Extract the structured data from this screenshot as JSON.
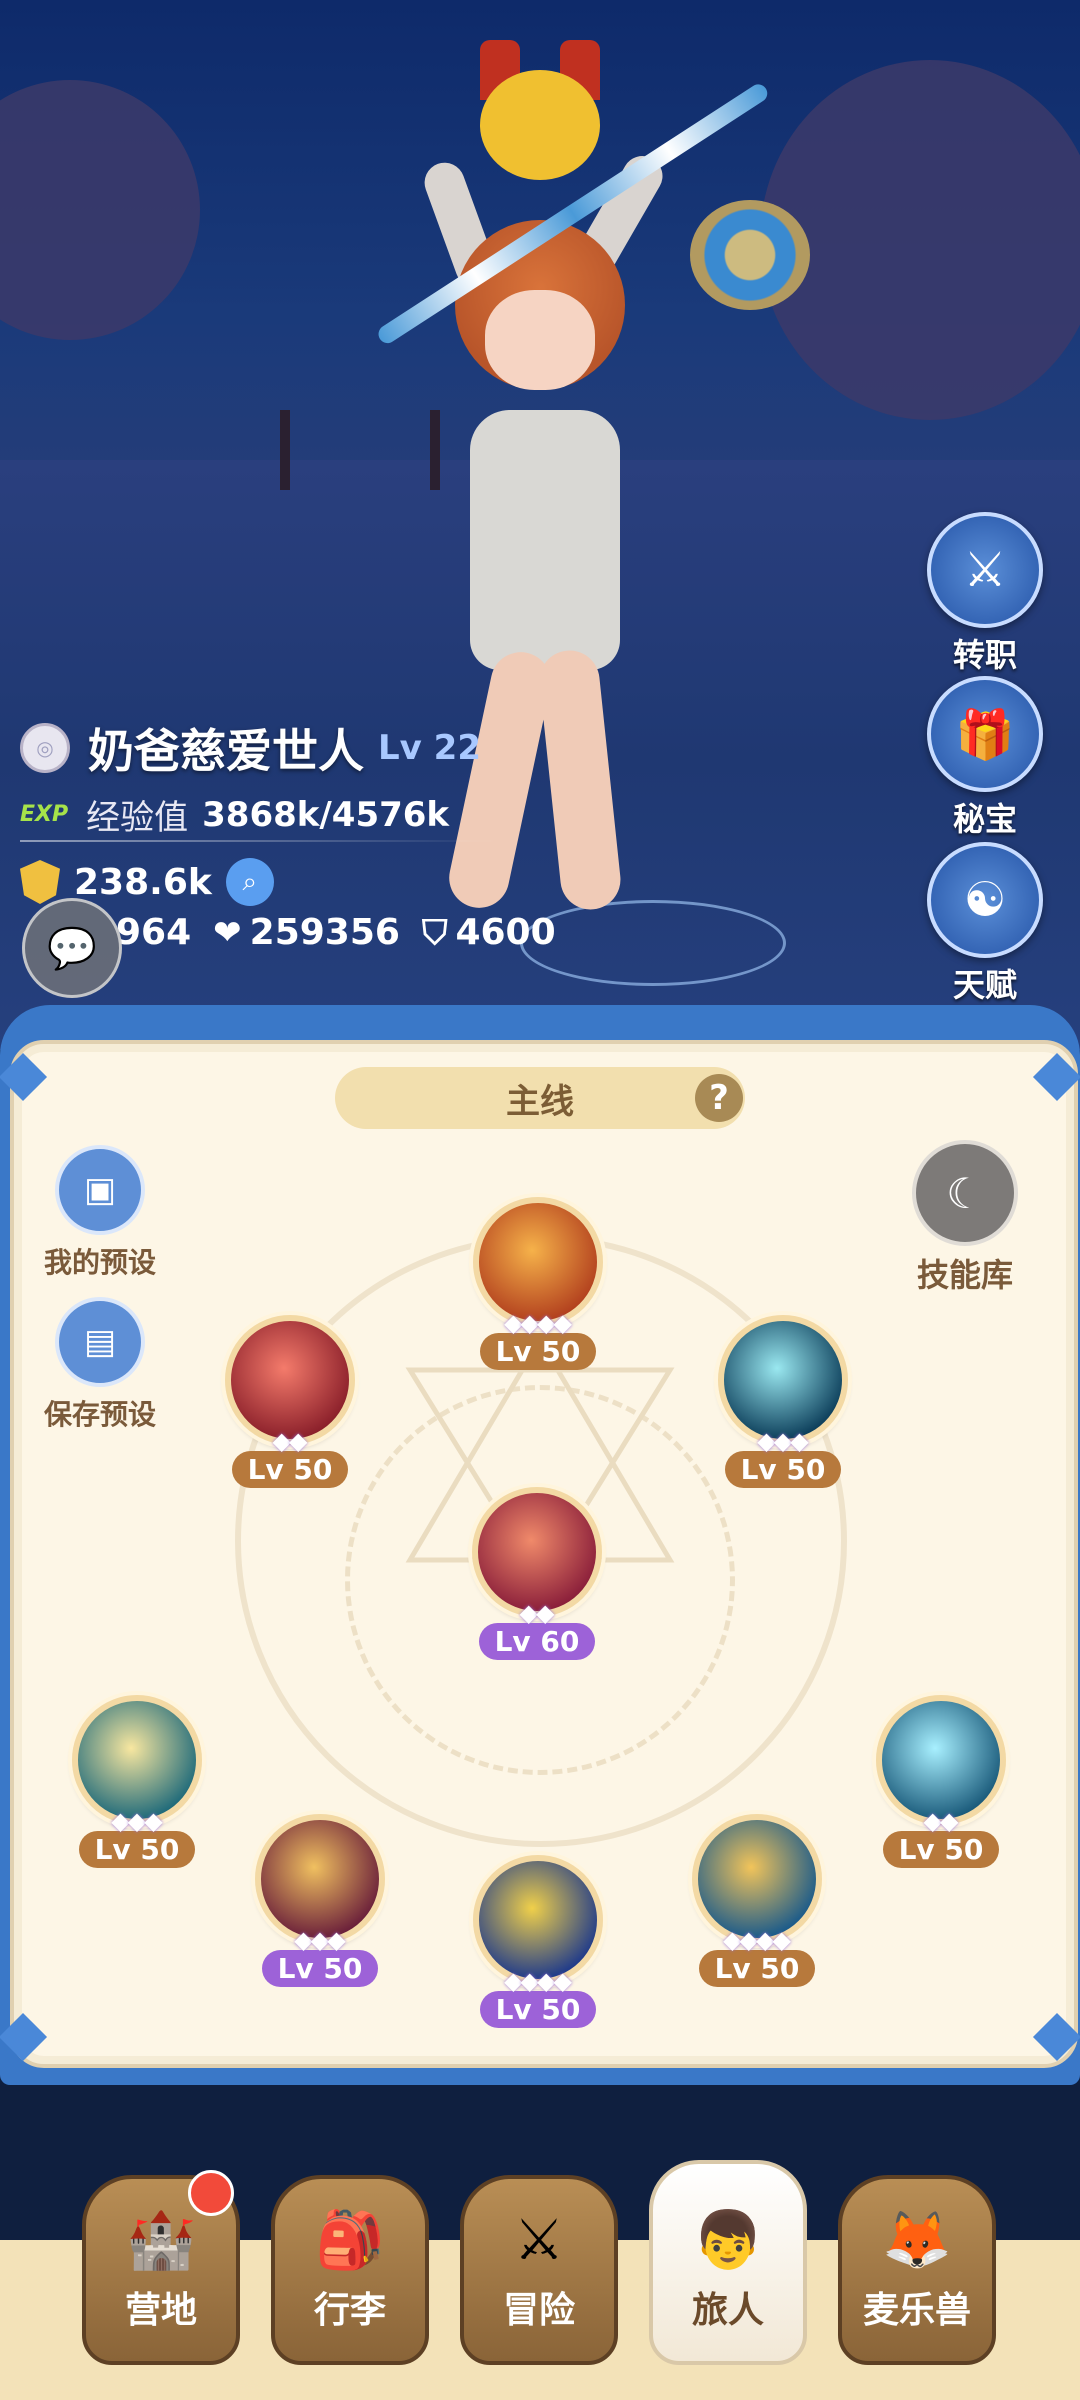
{
  "player": {
    "name": "奶爸慈爱世人",
    "level": "Lv 22",
    "exp_icon": "EXP",
    "exp_label": "经验值",
    "exp_value": "3868k/4576k",
    "power": "238.6k",
    "attack": "964",
    "hp": "259356",
    "defense": "4600"
  },
  "side_buttons": [
    {
      "label": "转职",
      "icon": "class-change-icon"
    },
    {
      "label": "秘宝",
      "icon": "treasure-icon"
    },
    {
      "label": "天赋",
      "icon": "talent-icon"
    }
  ],
  "panel": {
    "tab_label": "主线",
    "help": "?",
    "presets": [
      {
        "label": "我的预设",
        "icon": "card-icon"
      },
      {
        "label": "保存预设",
        "icon": "save-icon"
      }
    ],
    "library_label": "技能库"
  },
  "skills": [
    {
      "id": "top",
      "level": "Lv 50",
      "stars": 4,
      "badge": "brown",
      "colors": [
        "#f6b24a",
        "#b2401e"
      ]
    },
    {
      "id": "upper-left",
      "level": "Lv 50",
      "stars": 2,
      "badge": "brown",
      "colors": [
        "#f47b6b",
        "#8a1f2a"
      ]
    },
    {
      "id": "upper-right",
      "level": "Lv 50",
      "stars": 3,
      "badge": "brown",
      "colors": [
        "#9ae8f0",
        "#0c3e5a"
      ]
    },
    {
      "id": "center",
      "level": "Lv 60",
      "stars": 2,
      "badge": "purple",
      "colors": [
        "#f08a6a",
        "#8a1e3a"
      ]
    },
    {
      "id": "lower-left-outer",
      "level": "Lv 50",
      "stars": 3,
      "badge": "brown",
      "colors": [
        "#f8e7a0",
        "#1f6a7a"
      ]
    },
    {
      "id": "lower-left-inner",
      "level": "Lv 50",
      "stars": 3,
      "badge": "purple",
      "colors": [
        "#f0c060",
        "#6a1f3a"
      ]
    },
    {
      "id": "bottom-center",
      "level": "Lv 50",
      "stars": 4,
      "badge": "purple",
      "colors": [
        "#f0d04a",
        "#1f3a8a"
      ]
    },
    {
      "id": "lower-right-inner",
      "level": "Lv 50",
      "stars": 4,
      "badge": "brown",
      "colors": [
        "#f2c45a",
        "#1a5a8a"
      ]
    },
    {
      "id": "lower-right-outer",
      "level": "Lv 50",
      "stars": 2,
      "badge": "brown",
      "colors": [
        "#a8f0ff",
        "#1a5a7a"
      ]
    }
  ],
  "nav": [
    {
      "label": "营地",
      "icon": "castle-icon",
      "active": false,
      "notify": true
    },
    {
      "label": "行李",
      "icon": "backpack-icon",
      "active": false
    },
    {
      "label": "冒险",
      "icon": "crossed-swords-icon",
      "active": false
    },
    {
      "label": "旅人",
      "icon": "traveler-icon",
      "active": true
    },
    {
      "label": "麦乐兽",
      "icon": "pet-icon",
      "active": false
    }
  ]
}
